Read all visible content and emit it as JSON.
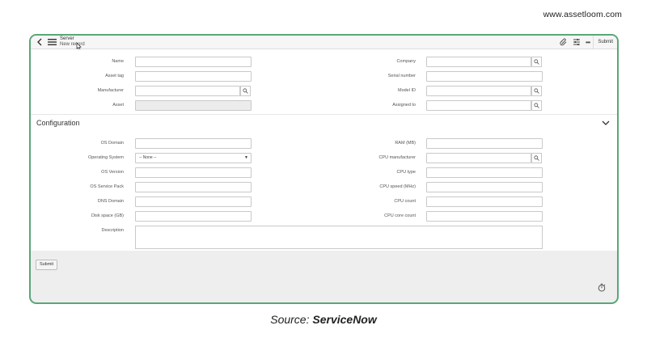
{
  "brand": {
    "url": "www.assetloom.com"
  },
  "header": {
    "title": "Server",
    "subtitle": "New record",
    "submit_label": "Submit",
    "icons": [
      "back-icon",
      "menu-icon",
      "attachment-icon",
      "settings-sliders-icon",
      "more-icon"
    ]
  },
  "main_fields": {
    "left": [
      {
        "label": "Name",
        "value": ""
      },
      {
        "label": "Asset tag",
        "value": ""
      },
      {
        "label": "Manufacturer",
        "value": ""
      },
      {
        "label": "Asset",
        "value": ""
      }
    ],
    "right": [
      {
        "label": "Company",
        "value": ""
      },
      {
        "label": "Serial number",
        "value": ""
      },
      {
        "label": "Model ID",
        "value": ""
      },
      {
        "label": "Assigned to",
        "value": ""
      }
    ]
  },
  "configuration": {
    "title": "Configuration",
    "left": [
      {
        "label": "OS Domain",
        "value": ""
      },
      {
        "label": "Operating System",
        "value": "-- None --"
      },
      {
        "label": "OS Version",
        "value": ""
      },
      {
        "label": "OS Service Pack",
        "value": ""
      },
      {
        "label": "DNS Domain",
        "value": ""
      },
      {
        "label": "Disk space (GB)",
        "value": ""
      }
    ],
    "right": [
      {
        "label": "RAM (MB)",
        "value": ""
      },
      {
        "label": "CPU manufacturer",
        "value": ""
      },
      {
        "label": "CPU type",
        "value": ""
      },
      {
        "label": "CPU speed (MHz)",
        "value": ""
      },
      {
        "label": "CPU count",
        "value": ""
      },
      {
        "label": "CPU core count",
        "value": ""
      }
    ],
    "description_label": "Description"
  },
  "footer": {
    "submit_label": "Submit"
  },
  "caption": {
    "prefix": "Source: ",
    "name": "ServiceNow"
  },
  "colors": {
    "frame_border": "#5aa678",
    "background": "#eeeeee"
  }
}
